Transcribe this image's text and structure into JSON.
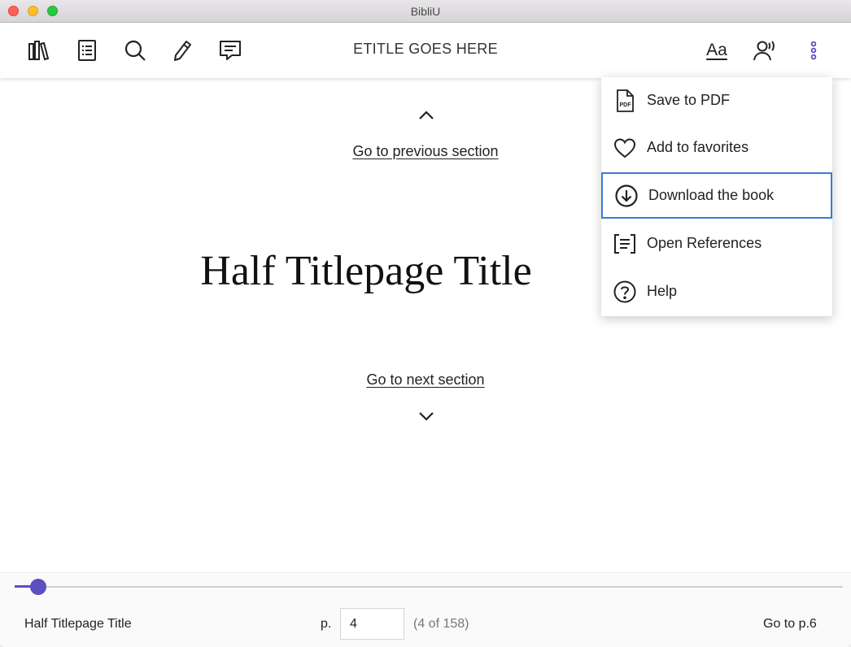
{
  "window": {
    "title": "BibliU"
  },
  "toolbar": {
    "book_title": "ETITLE GOES HERE",
    "font_button_label": "Aa",
    "icons": [
      "library-icon",
      "table-of-contents-icon",
      "search-icon",
      "highlight-pen-icon",
      "notes-icon",
      "font-settings-icon",
      "read-aloud-icon",
      "more-options-icon"
    ]
  },
  "content": {
    "previous_section": "Go to previous section",
    "next_section": "Go to next section",
    "half_title": "Half Titlepage Title"
  },
  "menu": {
    "items": [
      {
        "label": "Save to PDF",
        "icon": "pdf-icon"
      },
      {
        "label": "Add to favorites",
        "icon": "heart-icon"
      },
      {
        "label": "Download the book",
        "icon": "download-icon",
        "focused": true
      },
      {
        "label": "Open References",
        "icon": "references-icon"
      },
      {
        "label": "Help",
        "icon": "help-icon"
      }
    ]
  },
  "footer": {
    "section_title": "Half Titlepage Title",
    "page_prefix": "p.",
    "page_value": "4",
    "page_count_text": "(4 of 158)",
    "goto_label": "Go to p.6",
    "progress_fraction": 0.028
  },
  "colors": {
    "accent": "#5b4fc1",
    "focus": "#3a7bd5"
  }
}
